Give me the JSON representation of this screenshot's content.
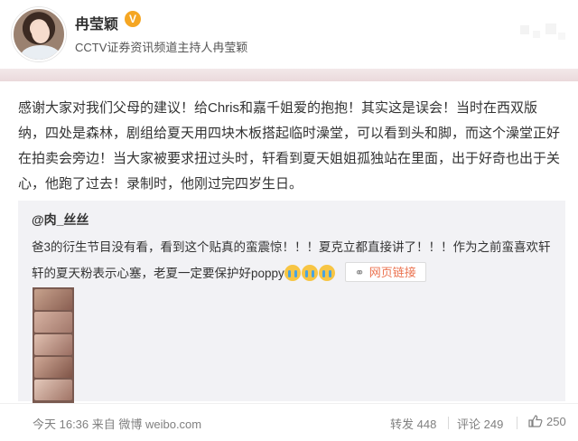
{
  "profile": {
    "name": "冉莹颖",
    "verified_badge": "V",
    "description": "CCTV证券资讯频道主持人冉莹颖",
    "avatar_icon": "avatar-photo"
  },
  "post": {
    "text": "感谢大家对我们父母的建议！给Chris和嘉千姐爱的抱抱！其实这是误会！当时在西双版纳，四处是森林，剧组给夏天用四块木板搭起临时澡堂，可以看到头和脚，而这个澡堂正好在拍卖会旁边！当大家被要求扭过头时，轩看到夏天姐姐孤独站在里面，出于好奇也出于关心，他跑了过去！录制时，他刚过完四岁生日。"
  },
  "repost": {
    "user": "@肉_丝丝",
    "text_part1": "爸3的衍生节目没有看，看到这个贴真的蛮震惊！！！夏克立都直接讲了！！！作为之前蛮喜欢轩轩的夏天粉表示心塞，老夏一定要保护好poppy",
    "emoji_count_label": "",
    "link_label": "网页链接",
    "link_icon": "link-icon"
  },
  "footer": {
    "time_source": "今天 16:36 来自 微博 weibo.com",
    "repost_label": "转发 448",
    "comment_label": "评论 249",
    "like_label": "250"
  },
  "colors": {
    "accent": "#eb7350",
    "badge": "#f5a623",
    "band": "#ecdcde"
  }
}
